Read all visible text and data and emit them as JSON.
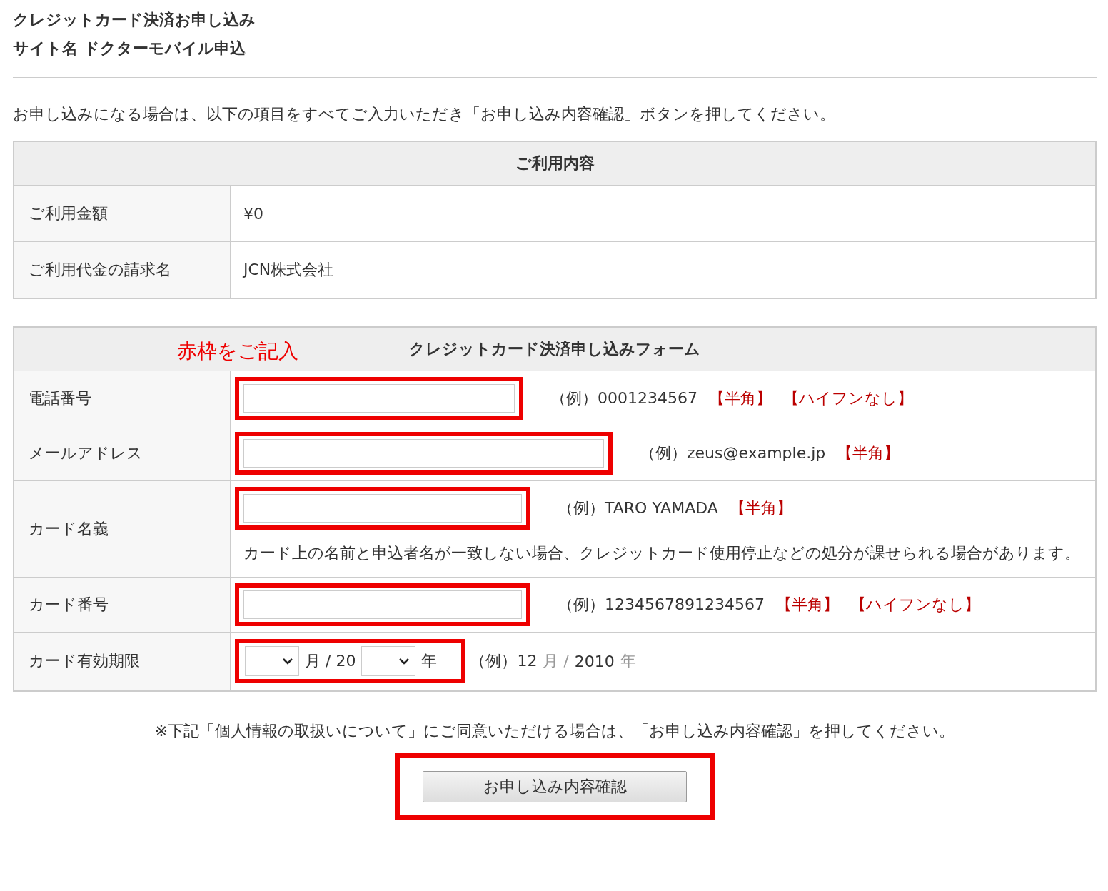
{
  "header": {
    "title": "クレジットカード決済お申し込み",
    "site_name": "サイト名 ドクターモバイル申込"
  },
  "intro": "お申し込みになる場合は、以下の項目をすべてご入力いただき「お申し込み内容確認」ボタンを押してください。",
  "usage_table": {
    "heading": "ご利用内容",
    "rows": [
      {
        "label": "ご利用金額",
        "value": "¥0"
      },
      {
        "label": "ご利用代金の請求名",
        "value": "JCN株式会社"
      }
    ]
  },
  "form": {
    "annotation": "赤枠をご記入",
    "heading": "クレジットカード決済申し込みフォーム",
    "rows": [
      {
        "kind": "text",
        "label": "電話番号",
        "example": "（例）0001234567",
        "tags": [
          "【半角】",
          "【ハイフンなし】"
        ]
      },
      {
        "kind": "text",
        "label": "メールアドレス",
        "example": "（例）zeus@example.jp",
        "tags": [
          "【半角】"
        ]
      },
      {
        "kind": "text",
        "label": "カード名義",
        "example": "（例）TARO YAMADA",
        "tags": [
          "【半角】"
        ],
        "note": "カード上の名前と申込者名が一致しない場合、クレジットカード使用停止などの処分が課せられる場合があります。"
      },
      {
        "kind": "text",
        "label": "カード番号",
        "example": "（例）1234567891234567",
        "tags": [
          "【半角】",
          "【ハイフンなし】"
        ]
      },
      {
        "kind": "expiry",
        "label": "カード有効期限",
        "month_unit": "月 / 20",
        "year_unit": "年",
        "example_parts": [
          {
            "text": "（例）12",
            "muted": false
          },
          {
            "text": "月 /",
            "muted": true
          },
          {
            "text": "2010",
            "muted": false
          },
          {
            "text": "年",
            "muted": true
          }
        ]
      }
    ]
  },
  "notice": "※下記「個人情報の取扱いについて」にご同意いただける場合は、「お申し込み内容確認」を押してください。",
  "confirm_button": "お申し込み内容確認"
}
